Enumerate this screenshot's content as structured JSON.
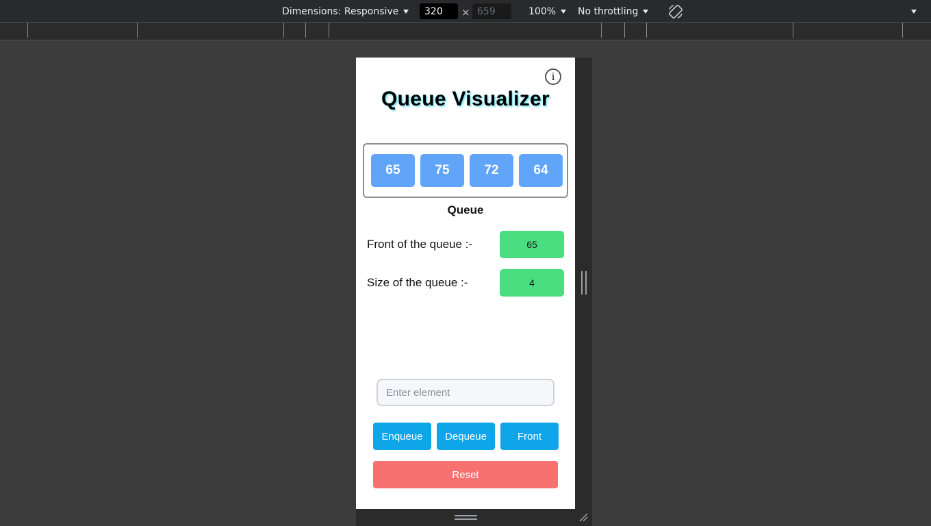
{
  "devtools": {
    "dimensions_label": "Dimensions: Responsive",
    "width_value": "320",
    "height_value": "659",
    "times": "×",
    "zoom": "100%",
    "throttling": "No throttling",
    "rotate_icon": "rotate-icon",
    "more_icon": "chevron-down-icon"
  },
  "app": {
    "title": "Queue Visualizer",
    "info_label": "i",
    "queue_items": [
      "65",
      "75",
      "72",
      "64"
    ],
    "queue_caption": "Queue",
    "front_label": "Front of the queue :-",
    "front_value": "65",
    "size_label": "Size of the queue :-",
    "size_value": "4",
    "input_placeholder": "Enter element",
    "input_value": "",
    "buttons": {
      "enqueue": "Enqueue",
      "dequeue": "Dequeue",
      "front": "Front",
      "reset": "Reset"
    },
    "colors": {
      "queue_item": "#60a5fa",
      "stat_value": "#4ade80",
      "op_button": "#0ea5e9",
      "reset_button": "#f87171"
    }
  }
}
